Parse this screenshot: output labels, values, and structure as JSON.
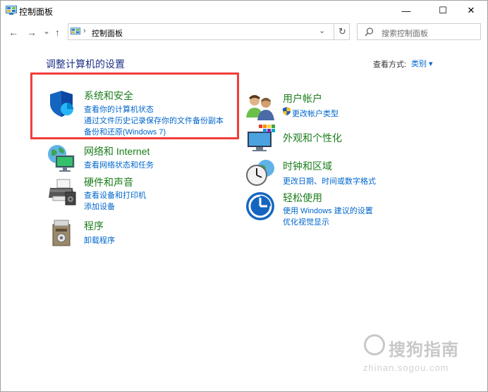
{
  "window": {
    "title": "控制面板",
    "minimize": "—",
    "maximize": "☐",
    "close": "✕"
  },
  "nav": {
    "back": "←",
    "forward": "→",
    "recent": "⌄",
    "up": "↑",
    "breadcrumb_sep": "›",
    "address": "控制面板",
    "refresh": "↻",
    "search_placeholder": "搜索控制面板"
  },
  "heading": "调整计算机的设置",
  "view_by": {
    "label": "查看方式:",
    "value": "类别 ▾"
  },
  "categories_left": [
    {
      "title": "系统和安全",
      "icon": "shield-icon",
      "links": [
        "查看你的计算机状态",
        "通过文件历史记录保存你的文件备份副本",
        "备份和还原(Windows 7)"
      ]
    },
    {
      "title": "网络和 Internet",
      "icon": "globe-network-icon",
      "links": [
        "查看网络状态和任务"
      ]
    },
    {
      "title": "硬件和声音",
      "icon": "printer-icon",
      "links": [
        "查看设备和打印机",
        "添加设备"
      ]
    },
    {
      "title": "程序",
      "icon": "programs-box-icon",
      "links": [
        "卸载程序"
      ]
    }
  ],
  "categories_right": [
    {
      "title": "用户帐户",
      "icon": "users-icon",
      "links": [
        "更改帐户类型"
      ]
    },
    {
      "title": "外观和个性化",
      "icon": "monitor-palette-icon",
      "links": []
    },
    {
      "title": "时钟和区域",
      "icon": "clock-globe-icon",
      "links": [
        "更改日期、时间或数字格式"
      ]
    },
    {
      "title": "轻松使用",
      "icon": "ease-of-access-icon",
      "links": [
        "使用 Windows 建议的设置",
        "优化视觉显示"
      ]
    }
  ],
  "watermark": {
    "brand": "搜狗指南",
    "url": "zhinan.sogou.com"
  },
  "colors": {
    "heading": "#1e3287",
    "category_title": "#1b7d1b",
    "link": "#0066cc",
    "highlight": "#f23c3c"
  }
}
